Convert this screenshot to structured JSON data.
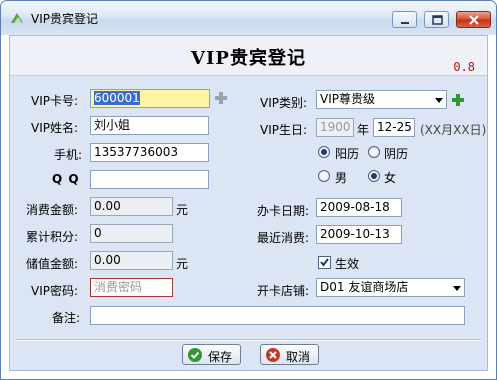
{
  "window": {
    "title": "VIP贵宾登记"
  },
  "header": {
    "title": "VIP贵宾登记",
    "version": "0.8"
  },
  "form": {
    "card_no": {
      "label": "VIP卡号:",
      "value": "600001"
    },
    "name": {
      "label": "VIP姓名:",
      "value": "刘小姐"
    },
    "phone": {
      "label": "手机:",
      "value": "13537736003"
    },
    "qq": {
      "label": "Q Q",
      "value": ""
    },
    "consume_amount": {
      "label": "消费金额:",
      "value": "0.00",
      "unit": "元"
    },
    "points": {
      "label": "累计积分:",
      "value": "0"
    },
    "stored_amount": {
      "label": "储值金额:",
      "value": "0.00",
      "unit": "元"
    },
    "password": {
      "label": "VIP密码:",
      "placeholder": "消费密码"
    },
    "category": {
      "label": "VIP类别:",
      "value": "VIP尊贵级"
    },
    "birthday": {
      "label": "VIP生日:",
      "year": "1900",
      "year_unit": "年",
      "monthday": "12-25",
      "format_hint": "(XX月XX日)"
    },
    "calendar": {
      "solar": "阳历",
      "lunar": "阴历",
      "selected": "solar"
    },
    "gender": {
      "male": "男",
      "female": "女",
      "selected": "female"
    },
    "issue_date": {
      "label": "办卡日期:",
      "value": "2009-08-18"
    },
    "last_consume": {
      "label": "最近消费:",
      "value": "2009-10-13"
    },
    "effective": {
      "label": "生效",
      "checked": true
    },
    "store": {
      "label": "开卡店铺:",
      "value": "D01 友谊商场店"
    },
    "remark": {
      "label": "备注:",
      "value": ""
    }
  },
  "buttons": {
    "save": "保存",
    "cancel": "取消"
  },
  "colors": {
    "accent_green": "#2f9a2f",
    "cancel_red": "#c0392b",
    "version_red": "#b01818"
  }
}
